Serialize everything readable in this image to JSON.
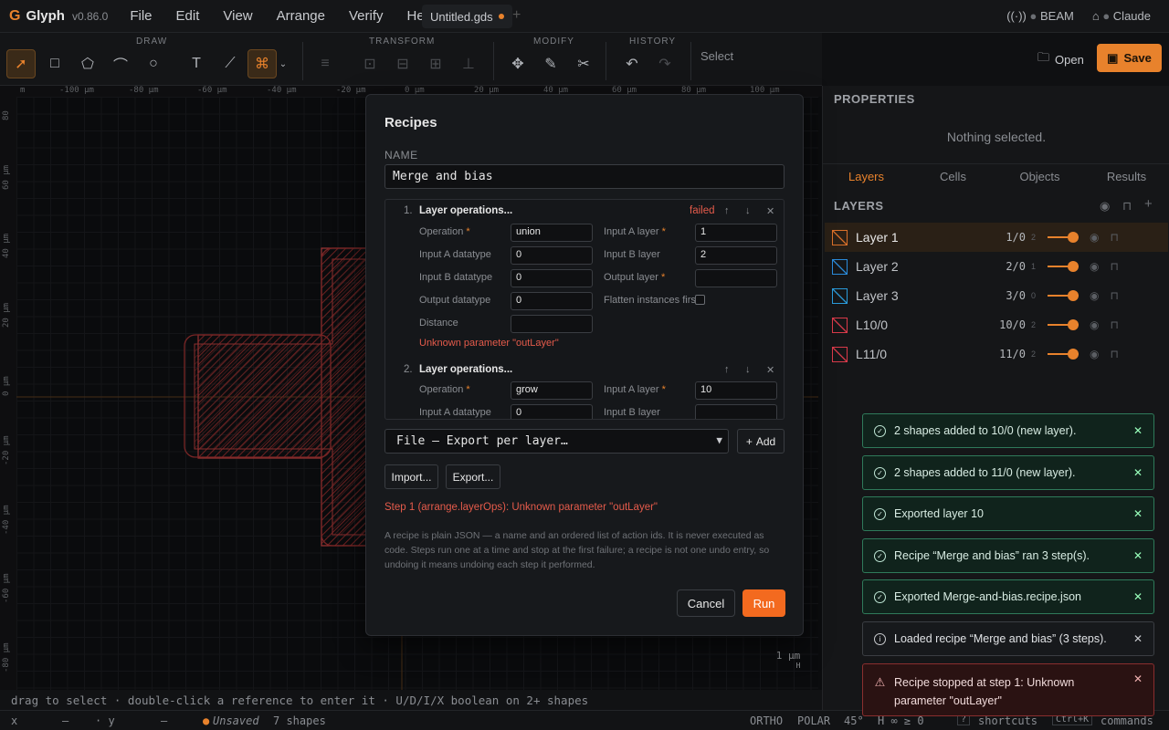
{
  "app": {
    "logo_glyph": "G",
    "name": "Glyph",
    "version": "v0.86.0"
  },
  "menus": [
    "File",
    "Edit",
    "View",
    "Arrange",
    "Verify",
    "Help"
  ],
  "document_tab": {
    "title": "Untitled.gds",
    "new_tab_glyph": "+"
  },
  "top_status": {
    "beam": "BEAM",
    "claude": "Claude"
  },
  "toolbar": {
    "groups": {
      "draw": "DRAW",
      "transform": "TRANSFORM",
      "modify": "MODIFY",
      "history": "HISTORY"
    },
    "mode_label": "Select",
    "open_label": "Open",
    "save_label": "Save"
  },
  "ruler": {
    "top_ticks": [
      "m",
      "-100 µm",
      "-80 µm",
      "-60 µm",
      "-40 µm",
      "-20 µm",
      "0 µm",
      "20 µm",
      "40 µm",
      "60 µm",
      "80 µm",
      "100 µm"
    ],
    "left_ticks": [
      "80",
      "60 µm",
      "40 µm",
      "20 µm",
      "0 µm",
      "-20 µm",
      "-40 µm",
      "-60 µm",
      "-80 µm"
    ]
  },
  "scale_bar": {
    "value": "1 µm",
    "sub": "H"
  },
  "hint": "drag to select · double-click a reference to enter it · U/D/I/X boolean on 2+ shapes",
  "statusbar": {
    "x_label": "x",
    "x_value": "—",
    "y_label": "· y",
    "y_value": "—",
    "unsaved": "Unsaved",
    "shapes": "7 shapes",
    "ortho": "ORTHO",
    "polar": "POLAR",
    "angle": "45°",
    "h_value": "H ∞ ≥ 0",
    "shortcuts_key": "?",
    "shortcuts": "shortcuts",
    "commands_key": "Ctrl+K",
    "commands": "commands"
  },
  "properties": {
    "title": "PROPERTIES",
    "empty": "Nothing selected."
  },
  "panel_tabs": [
    "Layers",
    "Cells",
    "Objects",
    "Results"
  ],
  "layers_header": "LAYERS",
  "layers": [
    {
      "name": "Layer 1",
      "num": "1/0",
      "count": "2",
      "color": "#d9702a"
    },
    {
      "name": "Layer 2",
      "num": "2/0",
      "count": "1",
      "color": "#2a8ad9"
    },
    {
      "name": "Layer 3",
      "num": "3/0",
      "count": "0",
      "color": "#2a9ad9"
    },
    {
      "name": "L10/0",
      "num": "10/0",
      "count": "2",
      "color": "#d93a4a"
    },
    {
      "name": "L11/0",
      "num": "11/0",
      "count": "2",
      "color": "#d93a4a"
    }
  ],
  "toasts": [
    {
      "kind": "ok",
      "text": "2 shapes added to 10/0 (new layer)."
    },
    {
      "kind": "ok",
      "text": "2 shapes added to 11/0 (new layer)."
    },
    {
      "kind": "ok",
      "text": "Exported layer 10"
    },
    {
      "kind": "ok",
      "text": "Recipe “Merge and bias” ran 3 step(s)."
    },
    {
      "kind": "ok",
      "text": "Exported Merge-and-bias.recipe.json"
    },
    {
      "kind": "info",
      "text": "Loaded recipe “Merge and bias” (3 steps)."
    },
    {
      "kind": "err",
      "text": "Recipe stopped at step 1: Unknown parameter \"outLayer\""
    }
  ],
  "dialog": {
    "title": "Recipes",
    "name_label": "NAME",
    "name_value": "Merge and bias",
    "steps": [
      {
        "num": "1.",
        "title": "Layer operations...",
        "state": "failed",
        "fields": {
          "operation_label": "Operation",
          "operation": "union",
          "input_a_layer_label": "Input A layer",
          "input_a_layer": "1",
          "input_a_datatype_label": "Input A datatype",
          "input_a_datatype": "0",
          "input_b_layer_label": "Input B layer",
          "input_b_layer": "2",
          "input_b_datatype_label": "Input B datatype",
          "input_b_datatype": "0",
          "output_layer_label": "Output layer",
          "output_layer": "",
          "output_datatype_label": "Output datatype",
          "output_datatype": "0",
          "flatten_label": "Flatten instances first",
          "distance_label": "Distance",
          "distance": ""
        },
        "error": "Unknown parameter \"outLayer\""
      },
      {
        "num": "2.",
        "title": "Layer operations...",
        "fields": {
          "operation_label": "Operation",
          "operation": "grow",
          "input_a_layer_label": "Input A layer",
          "input_a_layer": "10",
          "input_a_datatype_label": "Input A datatype",
          "input_a_datatype": "0",
          "input_b_layer_label": "Input B layer",
          "input_b_layer": ""
        }
      }
    ],
    "action_select": "File — Export per layer…",
    "add_label": "Add",
    "import_label": "Import...",
    "export_label": "Export...",
    "error": "Step 1 (arrange.layerOps): Unknown parameter \"outLayer\"",
    "help": "A recipe is plain JSON — a name and an ordered list of action ids. It is never executed as code. Steps run one at a time and stop at the first failure; a recipe is not one undo entry, so undoing it means undoing each step it performed.",
    "cancel_label": "Cancel",
    "run_label": "Run"
  }
}
